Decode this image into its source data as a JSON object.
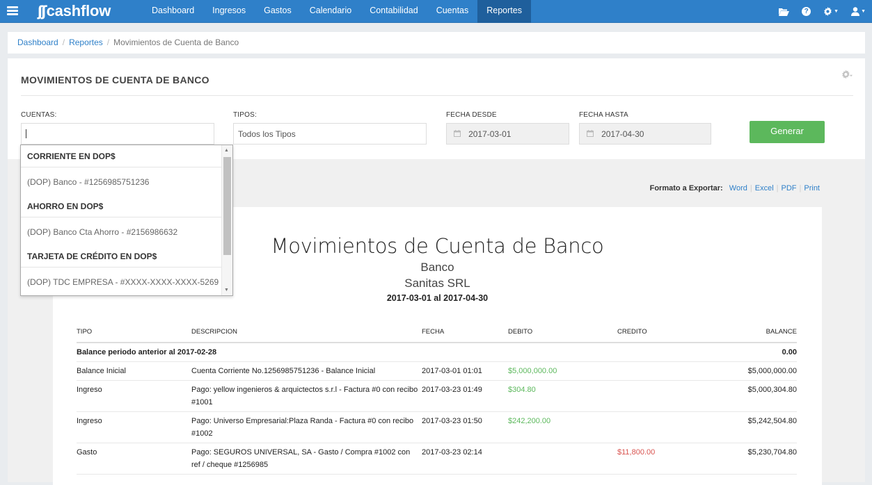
{
  "brand": {
    "name": "cashflow",
    "mark": "ʃʃ"
  },
  "nav": {
    "items": [
      {
        "label": "Dashboard"
      },
      {
        "label": "Ingresos"
      },
      {
        "label": "Gastos"
      },
      {
        "label": "Calendario"
      },
      {
        "label": "Contabilidad"
      },
      {
        "label": "Cuentas"
      },
      {
        "label": "Reportes",
        "active": true
      }
    ]
  },
  "topbar_icons": [
    "folder-open-icon",
    "help-icon",
    "gear-icon",
    "user-icon"
  ],
  "breadcrumb": {
    "items": [
      "Dashboard",
      "Reportes",
      "Movimientos de Cuenta de Banco"
    ]
  },
  "panel": {
    "title": "MOVIMIENTOS DE CUENTA DE BANCO"
  },
  "filters": {
    "cuentas_label": "CUENTAS:",
    "cuentas_value": "",
    "tipos_label": "TIPOS:",
    "tipos_value": "Todos los Tipos",
    "fecha_desde_label": "FECHA DESDE",
    "fecha_desde_value": "2017-03-01",
    "fecha_hasta_label": "FECHA HASTA",
    "fecha_hasta_value": "2017-04-30",
    "generate_label": "Generar"
  },
  "dropdown": {
    "items": [
      {
        "type": "group",
        "label": "CORRIENTE EN DOP$"
      },
      {
        "type": "option",
        "label": "(DOP) Banco - #1256985751236"
      },
      {
        "type": "group",
        "label": "AHORRO EN DOP$"
      },
      {
        "type": "option",
        "label": "(DOP) Banco Cta Ahorro - #2156986632"
      },
      {
        "type": "group",
        "label": "TARJETA DE CRÉDITO EN DOP$"
      },
      {
        "type": "option",
        "label": "(DOP) TDC EMPRESA - #XXXX-XXXX-XXXX-5269"
      }
    ]
  },
  "export": {
    "label": "Formato a Exportar:",
    "formats": [
      "Word",
      "Excel",
      "PDF",
      "Print"
    ]
  },
  "report": {
    "title": "Movimientos de Cuenta de Banco",
    "subtitle1": "Banco",
    "subtitle2": "Sanitas SRL",
    "range": "2017-03-01 al 2017-04-30",
    "columns": {
      "tipo": "TIPO",
      "descripcion": "DESCRIPCION",
      "fecha": "FECHA",
      "debito": "DEBITO",
      "credito": "CREDITO",
      "balance": "BALANCE"
    },
    "prior_balance_label": "Balance periodo anterior al 2017-02-28",
    "prior_balance_value": "0.00",
    "rows": [
      {
        "tipo": "Balance Inicial",
        "descripcion": "Cuenta Corriente No.1256985751236 - Balance Inicial",
        "fecha": "2017-03-01 01:01",
        "debito": "$5,000,000.00",
        "credito": "",
        "balance": "$5,000,000.00"
      },
      {
        "tipo": "Ingreso",
        "descripcion": "Pago: yellow ingenieros & arquictectos s.r.l - Factura #0 con recibo #1001",
        "fecha": "2017-03-23 01:49",
        "debito": "$304.80",
        "credito": "",
        "balance": "$5,000,304.80"
      },
      {
        "tipo": "Ingreso",
        "descripcion": "Pago: Universo Empresarial:Plaza Randa - Factura #0 con recibo #1002",
        "fecha": "2017-03-23 01:50",
        "debito": "$242,200.00",
        "credito": "",
        "balance": "$5,242,504.80"
      },
      {
        "tipo": "Gasto",
        "descripcion": "Pago: SEGUROS UNIVERSAL, SA - Gasto / Compra #1002 con ref / cheque #1256985",
        "fecha": "2017-03-23 02:14",
        "debito": "",
        "credito": "$11,800.00",
        "balance": "$5,230,704.80"
      }
    ]
  }
}
